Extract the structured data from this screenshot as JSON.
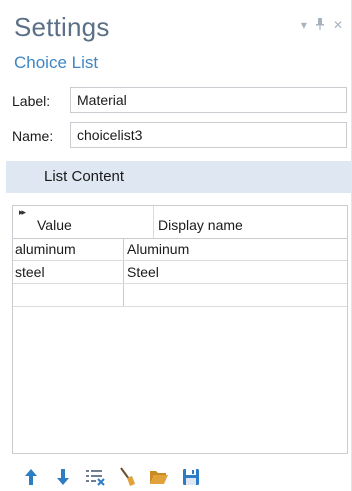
{
  "header": {
    "title": "Settings",
    "subtitle": "Choice List"
  },
  "form": {
    "label_caption": "Label:",
    "label_value": "Material",
    "name_caption": "Name:",
    "name_value": "choicelist3"
  },
  "section": {
    "title": "List Content"
  },
  "table": {
    "columns": [
      "Value",
      "Display name"
    ],
    "rows": [
      {
        "value": "aluminum",
        "display": "Aluminum"
      },
      {
        "value": "steel",
        "display": "Steel"
      },
      {
        "value": "",
        "display": ""
      }
    ]
  },
  "toolbar": {
    "icons": [
      "move-up-icon",
      "move-down-icon",
      "clear-list-icon",
      "sweep-icon",
      "open-folder-icon",
      "save-icon"
    ]
  },
  "colors": {
    "title": "#5b6f86",
    "subtitle": "#3f86c4",
    "section_bg": "#dfe8f2",
    "toolbar_blue": "#2d7cc4",
    "folder_orange": "#e2a23b"
  }
}
